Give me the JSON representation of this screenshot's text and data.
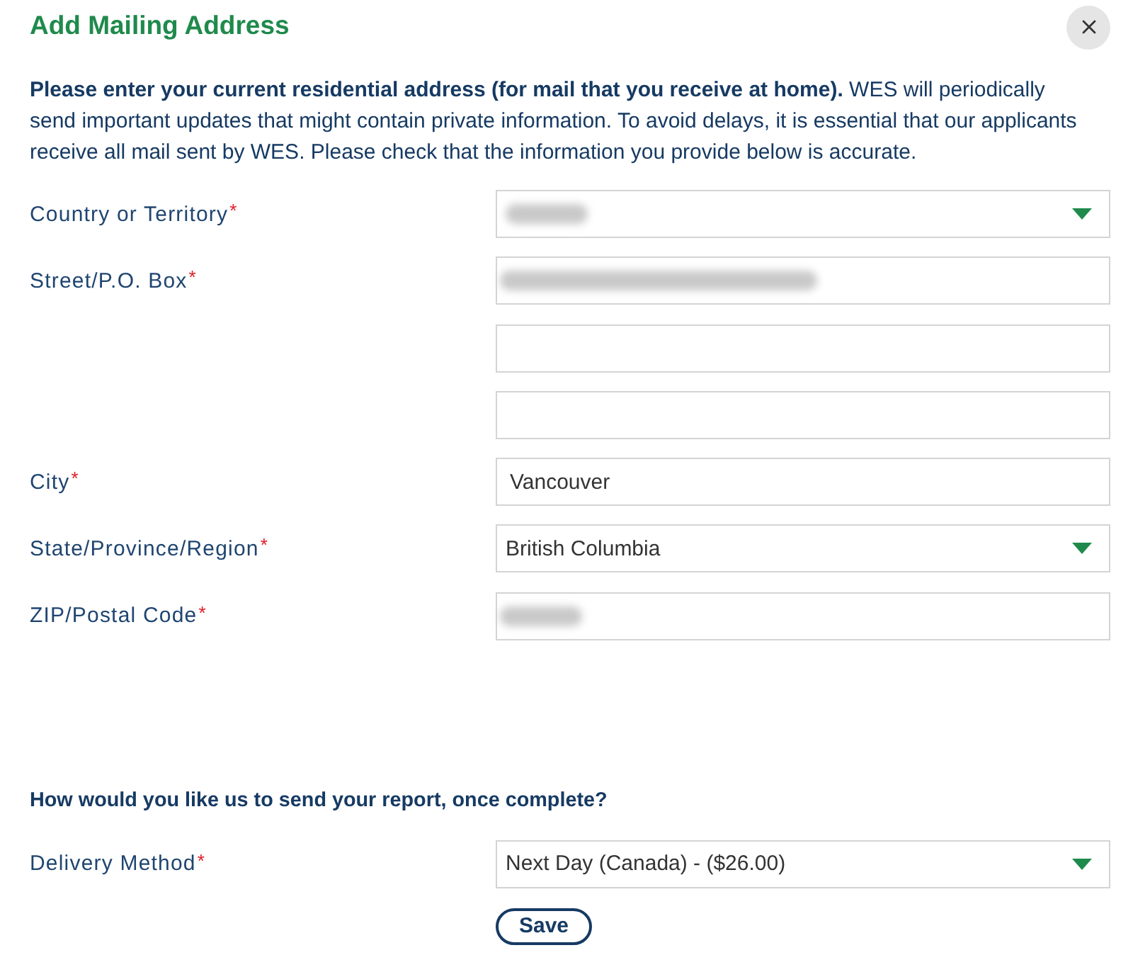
{
  "dialog": {
    "title": "Add Mailing Address"
  },
  "intro": "**Please enter your current residential address (for mail that you receive at home).** WES will periodically send important updates that might contain private information. To avoid delays, it is essential that our applicants receive all mail sent by WES. Please check that the information you provide below is accurate.",
  "address_fields": [
    {
      "label": "Country or Territory",
      "required_mark": "*",
      "kind": "select",
      "blur": {
        "kind": "short"
      }
    },
    {
      "label": "Street/P.O. Box",
      "required_mark": "*",
      "kind": "text",
      "blur": {
        "kind": "long"
      }
    },
    {
      "kind": "text"
    },
    {
      "kind": "text"
    },
    {
      "label": "City",
      "required_mark": "*",
      "kind": "text",
      "value": "Vancouver"
    },
    {
      "label": "State/Province/Region",
      "required_mark": "*",
      "kind": "select",
      "value": "British Columbia"
    },
    {
      "label": "ZIP/Postal Code",
      "required_mark": "*",
      "kind": "text",
      "blur": {
        "kind": "short"
      }
    }
  ],
  "delivery": {
    "question": "How would you like us to send your report, once complete?",
    "fields": [
      {
        "label": "Delivery Method",
        "required_mark": "*",
        "kind": "select",
        "value": "Next Day (Canada) - ($26.00)"
      }
    ]
  },
  "save_button": "Save"
}
